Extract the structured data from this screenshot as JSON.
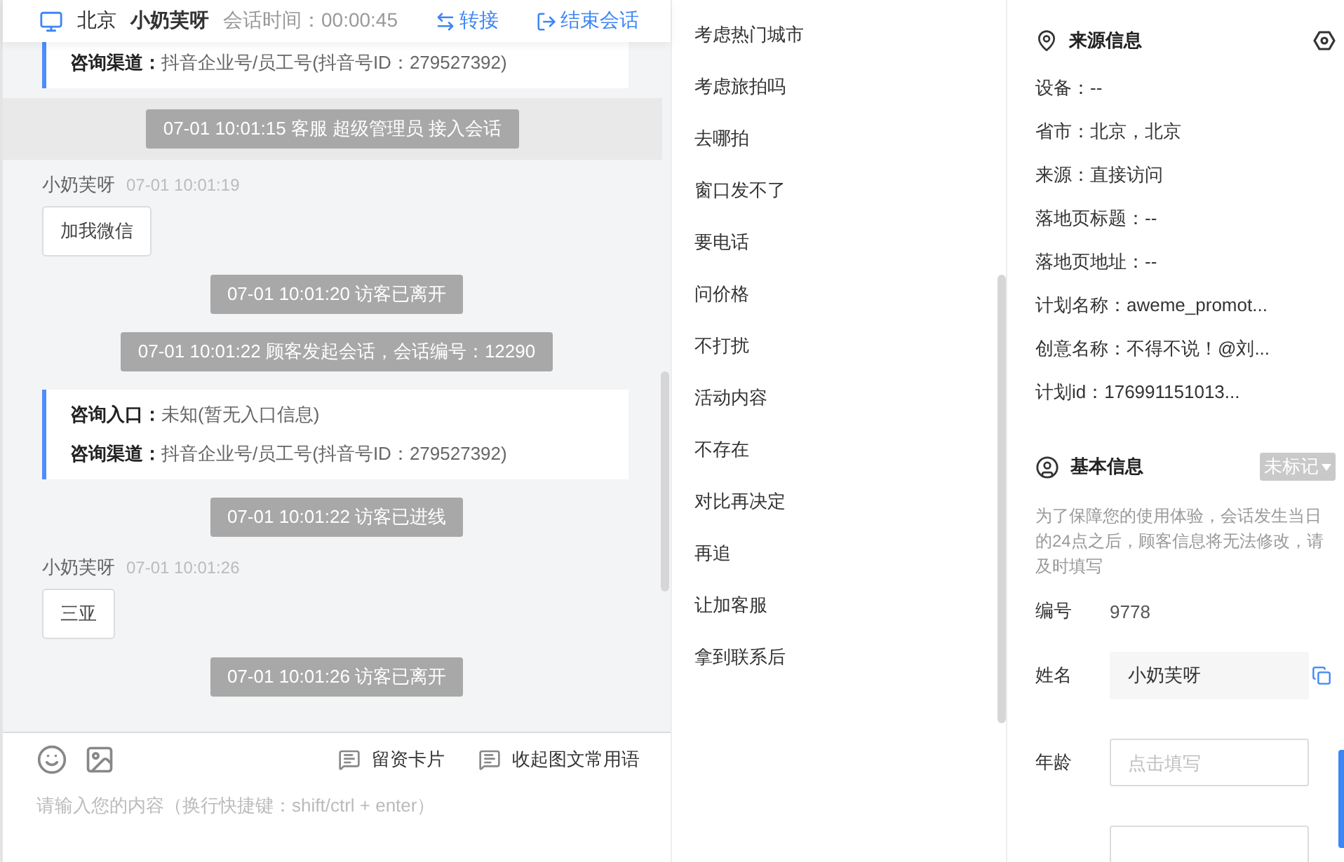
{
  "header": {
    "location": "北京",
    "name": "小奶芙呀",
    "session_time": "会话时间：00:00:45",
    "actions": [
      {
        "kind": "transfer",
        "label": "转接"
      },
      {
        "kind": "end",
        "label": "结束会话"
      }
    ]
  },
  "messages": [
    {
      "kind": "card",
      "lines": [
        "**咨询渠道：**抖音企业号/员工号(抖音号ID：279527392)"
      ]
    },
    {
      "kind": "system",
      "text": "07-01 10:01:15 客服 超级管理员 接入会话",
      "highlighted": true
    },
    {
      "kind": "visitor",
      "name": "小奶芙呀",
      "time": "07-01 10:01:19",
      "text": "加我微信"
    },
    {
      "kind": "system",
      "text": "07-01 10:01:20 访客已离开",
      "highlighted": false
    },
    {
      "kind": "system",
      "text": "07-01 10:01:22 顾客发起会话，会话编号：12290",
      "highlighted": false
    },
    {
      "kind": "card",
      "lines": [
        "**咨询入口：**未知(暂无入口信息)",
        "**咨询渠道：**抖音企业号/员工号(抖音号ID：279527392)"
      ]
    },
    {
      "kind": "system",
      "text": "07-01 10:01:22 访客已进线",
      "highlighted": false
    },
    {
      "kind": "visitor",
      "name": "小奶芙呀",
      "time": "07-01 10:01:26",
      "text": "三亚"
    },
    {
      "kind": "system",
      "text": "07-01 10:01:26 访客已离开",
      "highlighted": false
    }
  ],
  "input": {
    "tools": [
      {
        "kind": "emoji"
      },
      {
        "kind": "image"
      }
    ],
    "buttons": [
      {
        "kind": "card",
        "label": "留资卡片"
      },
      {
        "kind": "collapse",
        "label": "收起图文常用语"
      }
    ],
    "placeholder": "请输入您的内容（换行快捷键：shift/ctrl + enter）"
  },
  "phrases": [
    "考虑热门城市",
    "考虑旅拍吗",
    "去哪拍",
    "窗口发不了",
    "要电话",
    "问价格",
    "不打扰",
    "活动内容",
    "不存在",
    "对比再决定",
    "再追",
    "让加客服",
    "拿到联系后"
  ],
  "source_info": {
    "title": "来源信息",
    "rows": [
      "设备：--",
      "省市：北京，北京",
      "来源：直接访问",
      "落地页标题：--",
      "落地页地址：--",
      "计划名称：aweme_promot...",
      "创意名称：不得不说！@刘...",
      "计划id：176991151013..."
    ]
  },
  "basic_info": {
    "title": "基本信息",
    "tag": "未标记",
    "note": "为了保障您的使用体验，会话发生当日的24点之后，顾客信息将无法修改，请及时填写",
    "fields": [
      {
        "kind": "text",
        "label": "编号",
        "value": "9778"
      },
      {
        "kind": "input",
        "label": "姓名",
        "value": "小奶芙呀",
        "copy": true
      },
      {
        "kind": "input",
        "label": "年龄",
        "placeholder": "点击填写"
      },
      {
        "kind": "input"
      }
    ]
  }
}
